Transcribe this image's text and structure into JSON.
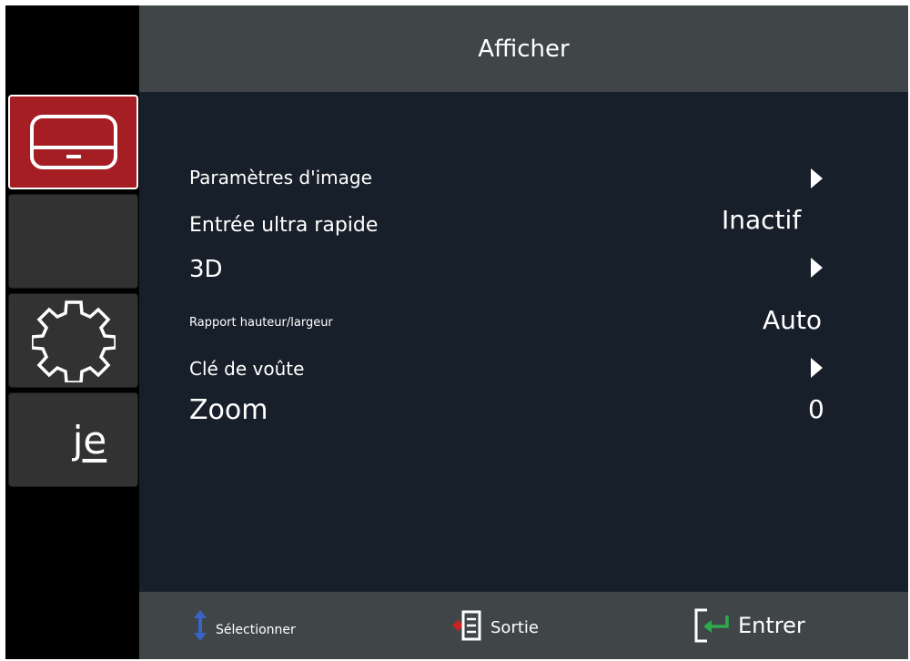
{
  "header": {
    "title": "Afficher"
  },
  "sidebar": {
    "tabs": [
      {
        "icon": "display-icon",
        "active": true
      },
      {
        "icon": "blank-tab",
        "active": false
      },
      {
        "icon": "gear-icon",
        "active": false
      },
      {
        "icon": "info-icon",
        "label": "je",
        "active": false
      }
    ]
  },
  "menu": {
    "items": [
      {
        "label": "Paramètres d'image",
        "value": ""
      },
      {
        "label": "Entrée ultra rapide",
        "value": "Inactif"
      },
      {
        "label": "3D",
        "value": ""
      },
      {
        "label": "Rapport hauteur/largeur",
        "value": "Auto"
      },
      {
        "label": "Clé de voûte",
        "value": ""
      },
      {
        "label": "Zoom",
        "value": "0"
      }
    ]
  },
  "footer": {
    "select_label": "Sélectionner",
    "exit_label": "Sortie",
    "enter_label": "Entrer"
  },
  "colors": {
    "accent_red": "#a41e24",
    "header_bg": "#404648",
    "content_bg": "#17202a",
    "select_arrow": "#3a63c8",
    "exit_arrow": "#d02020",
    "enter_arrow": "#2fa84f"
  }
}
